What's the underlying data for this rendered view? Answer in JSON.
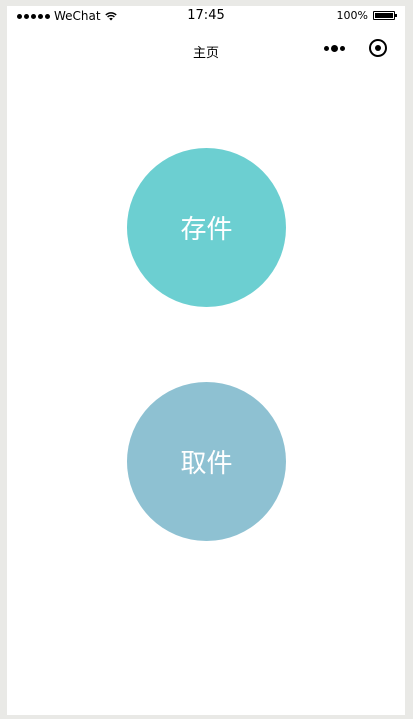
{
  "status_bar": {
    "carrier": "WeChat",
    "time": "17:45",
    "battery": "100%",
    "battery_level": 1.0,
    "icons": [
      "signal-dots-icon",
      "wifi-icon",
      "battery-icon"
    ]
  },
  "nav": {
    "title": "主页",
    "icons": [
      "more-icon",
      "close-icon"
    ]
  },
  "actions": {
    "store_label": "存件",
    "pickup_label": "取件"
  },
  "colors": {
    "store": "#6ccfd1",
    "pickup": "#8ec1d2",
    "background": "#ffffff",
    "frame": "#e9e9e6"
  }
}
